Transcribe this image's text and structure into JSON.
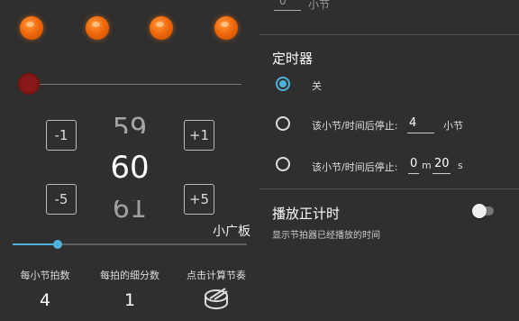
{
  "metronome": {
    "beat_indicators": 4,
    "bpm": {
      "previous": "59",
      "current": "60",
      "next": "61"
    },
    "buttons": {
      "minus1": "-1",
      "plus1": "+1",
      "minus5": "-5",
      "plus5": "+5"
    },
    "tempo_name": "小广板",
    "beats_per_bar": {
      "label": "每小节拍数",
      "value": "4"
    },
    "subdivisions": {
      "label": "每拍的细分数",
      "value": "1"
    },
    "tap_tempo": {
      "label": "点击计算节奏",
      "icon": "drum-icon"
    },
    "accent_color": "#4fb3d9",
    "beat_color": "#f06a0c"
  },
  "settings": {
    "top_partial": {
      "value": "0",
      "unit": "小节"
    },
    "timer": {
      "title": "定时器",
      "options": [
        {
          "label": "关",
          "selected": true
        },
        {
          "label": "该小节/时间后停止:",
          "value": "4",
          "unit": "小节",
          "selected": false
        },
        {
          "label": "该小节/时间后停止:",
          "minutes": "0",
          "minutes_unit": "m",
          "seconds": "20",
          "seconds_unit": "s",
          "selected": false
        }
      ]
    },
    "play_timer": {
      "title": "播放正计时",
      "description": "显示节拍器已经播放的时间",
      "enabled": false
    }
  }
}
